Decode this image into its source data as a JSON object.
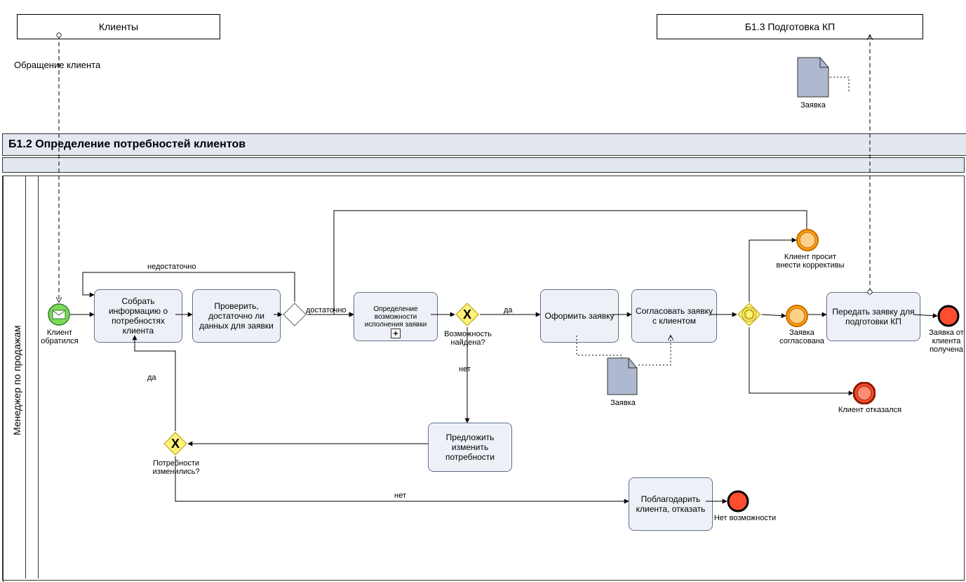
{
  "participants": {
    "clients": "Клиенты",
    "prepare_kp": "Б1.3 Подготовка КП"
  },
  "messages": {
    "client_request": "Обращение клиента",
    "request_artifact_top": "Заявка"
  },
  "pool": {
    "title": "Б1.2 Определение потребностей клиентов",
    "lane": "Менеджер по продажам"
  },
  "events": {
    "start": "Клиент обратился",
    "int_corrections": "Клиент просит внести коррективы",
    "int_agreed": "Заявка согласована",
    "int_refused": "Клиент отказался",
    "end_no_possibility": "Нет возможности",
    "end_received": "Заявка от клиента получена"
  },
  "tasks": {
    "collect": "Собрать информацию о потребностях клиента",
    "check": "Проверить, достаточно ли данных для заявки",
    "determine": "Определение возможности исполнения заявки",
    "form": "Оформить заявку",
    "agree": "Согласовать заявку с клиентом",
    "transfer": "Передать заявку для подготовки КП",
    "propose": "Предложить изменить потребности",
    "thank": "Поблагодарить клиента, отказать"
  },
  "gateways": {
    "enough_q": "",
    "possibility_q": "Возможность найдена?",
    "needs_changed_q": "Потребности изменились?",
    "event_based": ""
  },
  "edges": {
    "not_enough": "недостаточно",
    "enough": "достаточно",
    "yes1": "да",
    "no1": "нет",
    "yes2": "да",
    "no2": "нет"
  },
  "artifacts": {
    "request_mid": "Заявка"
  }
}
